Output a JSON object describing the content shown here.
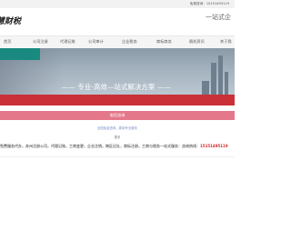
{
  "topbar": {
    "promo": "免费咨询：15151495119"
  },
  "logo": {
    "text": "慧财税"
  },
  "slogan": {
    "text": "一站式企"
  },
  "nav": {
    "items": [
      "首页",
      "公司注册",
      "代理记账",
      "公司审计",
      "企业税务",
      "商标商务",
      "随机资讯",
      "关于我"
    ]
  },
  "hero": {
    "tagline": "—— 专业·高效—站式解决方案 ——"
  },
  "cta": {
    "label": "电话咨询"
  },
  "hint": {
    "text": "全国免费咨询，周到专业服务"
  },
  "more": {
    "text": "更多"
  },
  "services": {
    "text": "免费服务代办，苏州注册公司，代理记账，工商变更，企业注销，跨区迁址，商标注册，工商与税务一站式服务：咨询热线：",
    "phone": "15151495119"
  },
  "colors": {
    "teal": "#1a8a80",
    "red": "#c93038",
    "pink": "#e4788a"
  }
}
